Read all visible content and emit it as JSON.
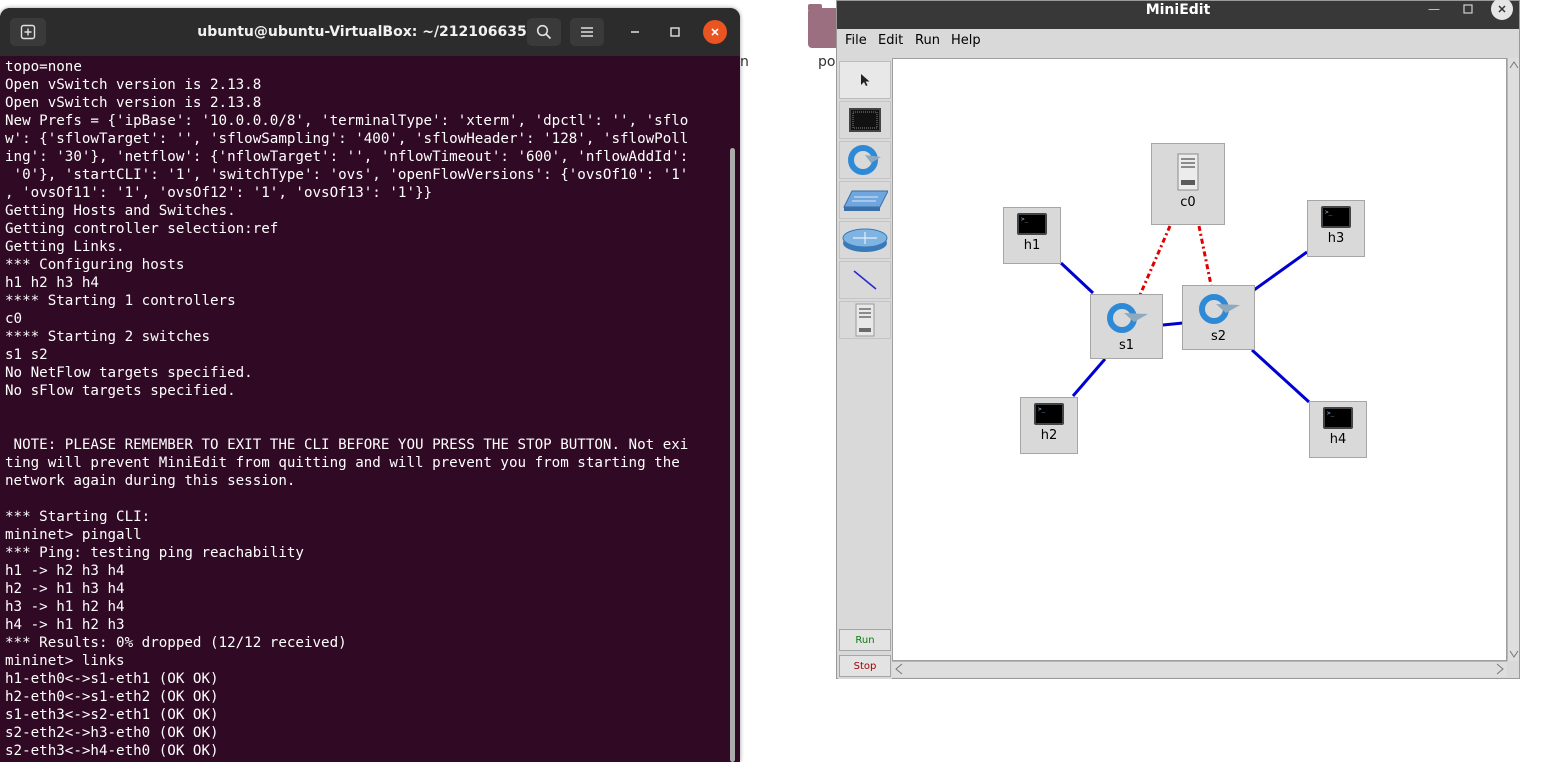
{
  "desktop": {
    "icon1_label": "n",
    "icon2_label": "po"
  },
  "terminal": {
    "title": "ubuntu@ubuntu-VirtualBox: ~/212106635",
    "lines": [
      "topo=none",
      "Open vSwitch version is 2.13.8",
      "Open vSwitch version is 2.13.8",
      "New Prefs = {'ipBase': '10.0.0.0/8', 'terminalType': 'xterm', 'dpctl': '', 'sflo",
      "w': {'sflowTarget': '', 'sflowSampling': '400', 'sflowHeader': '128', 'sflowPoll",
      "ing': '30'}, 'netflow': {'nflowTarget': '', 'nflowTimeout': '600', 'nflowAddId':",
      " '0'}, 'startCLI': '1', 'switchType': 'ovs', 'openFlowVersions': {'ovsOf10': '1'",
      ", 'ovsOf11': '1', 'ovsOf12': '1', 'ovsOf13': '1'}}",
      "Getting Hosts and Switches.",
      "Getting controller selection:ref",
      "Getting Links.",
      "*** Configuring hosts",
      "h1 h2 h3 h4",
      "**** Starting 1 controllers",
      "c0",
      "**** Starting 2 switches",
      "s1 s2",
      "No NetFlow targets specified.",
      "No sFlow targets specified.",
      "",
      "",
      " NOTE: PLEASE REMEMBER TO EXIT THE CLI BEFORE YOU PRESS THE STOP BUTTON. Not exi",
      "ting will prevent MiniEdit from quitting and will prevent you from starting the",
      "network again during this session.",
      "",
      "*** Starting CLI:",
      "mininet> pingall",
      "*** Ping: testing ping reachability",
      "h1 -> h2 h3 h4",
      "h2 -> h1 h3 h4",
      "h3 -> h1 h2 h4",
      "h4 -> h1 h2 h3",
      "*** Results: 0% dropped (12/12 received)",
      "mininet> links",
      "h1-eth0<->s1-eth1 (OK OK)",
      "h2-eth0<->s1-eth2 (OK OK)",
      "s1-eth3<->s2-eth1 (OK OK)",
      "s2-eth2<->h3-eth0 (OK OK)",
      "s2-eth3<->h4-eth0 (OK OK)"
    ]
  },
  "miniedit": {
    "title": "MiniEdit",
    "menus": [
      "File",
      "Edit",
      "Run",
      "Help"
    ],
    "run_label": "Run",
    "stop_label": "Stop",
    "nodes": {
      "c0": "c0",
      "h1": "h1",
      "h2": "h2",
      "h3": "h3",
      "h4": "h4",
      "s1": "s1",
      "s2": "s2"
    }
  },
  "colors": {
    "terminal_bg": "#300a24",
    "link": "#0000d0",
    "controller_link": "#e00000",
    "run_text": "#0a7a0a",
    "stop_text": "#a00000"
  }
}
